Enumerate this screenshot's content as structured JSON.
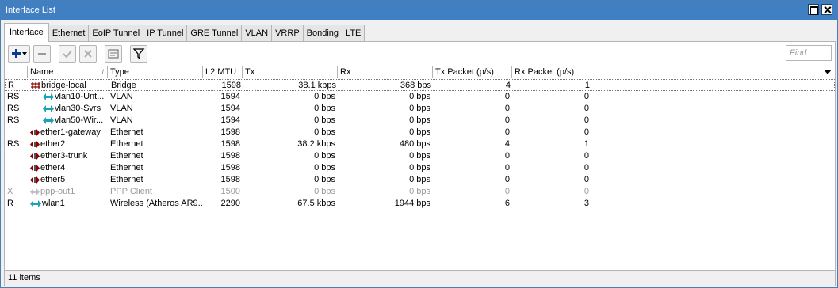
{
  "window": {
    "title": "Interface List"
  },
  "tabs": [
    "Interface",
    "Ethernet",
    "EoIP Tunnel",
    "IP Tunnel",
    "GRE Tunnel",
    "VLAN",
    "VRRP",
    "Bonding",
    "LTE"
  ],
  "toolbar": {
    "add": "plus-icon",
    "remove": "minus-icon",
    "enable": "check-icon",
    "disable": "x-icon",
    "comment": "note-icon",
    "filter": "filter-icon",
    "find_placeholder": "Find"
  },
  "columns": {
    "flag": "",
    "name": "Name",
    "sort": "/",
    "type": "Type",
    "mtu": "L2 MTU",
    "tx": "Tx",
    "rx": "Rx",
    "txp": "Tx Packet (p/s)",
    "rxp": "Rx Packet (p/s)"
  },
  "rows": [
    {
      "flag": "R",
      "icon": "bridge-icon",
      "name": "bridge-local",
      "type": "Bridge",
      "mtu": "1598",
      "tx": "38.1 kbps",
      "rx": "368 bps",
      "txp": "4",
      "rxp": "1",
      "disabled": false
    },
    {
      "flag": "RS",
      "icon": "vlan-icon",
      "name": "vlan10-Unt...",
      "type": "VLAN",
      "mtu": "1594",
      "tx": "0 bps",
      "rx": "0 bps",
      "txp": "0",
      "rxp": "0",
      "disabled": false
    },
    {
      "flag": "RS",
      "icon": "vlan-icon",
      "name": "vlan30-Svrs",
      "type": "VLAN",
      "mtu": "1594",
      "tx": "0 bps",
      "rx": "0 bps",
      "txp": "0",
      "rxp": "0",
      "disabled": false
    },
    {
      "flag": "RS",
      "icon": "vlan-icon",
      "name": "vlan50-Wir...",
      "type": "VLAN",
      "mtu": "1594",
      "tx": "0 bps",
      "rx": "0 bps",
      "txp": "0",
      "rxp": "0",
      "disabled": false
    },
    {
      "flag": "",
      "icon": "ethernet-icon",
      "name": "ether1-gateway",
      "type": "Ethernet",
      "mtu": "1598",
      "tx": "0 bps",
      "rx": "0 bps",
      "txp": "0",
      "rxp": "0",
      "disabled": false
    },
    {
      "flag": "RS",
      "icon": "ethernet-icon",
      "name": "ether2",
      "type": "Ethernet",
      "mtu": "1598",
      "tx": "38.2 kbps",
      "rx": "480 bps",
      "txp": "4",
      "rxp": "1",
      "disabled": false
    },
    {
      "flag": "",
      "icon": "ethernet-icon",
      "name": "ether3-trunk",
      "type": "Ethernet",
      "mtu": "1598",
      "tx": "0 bps",
      "rx": "0 bps",
      "txp": "0",
      "rxp": "0",
      "disabled": false
    },
    {
      "flag": "",
      "icon": "ethernet-icon",
      "name": "ether4",
      "type": "Ethernet",
      "mtu": "1598",
      "tx": "0 bps",
      "rx": "0 bps",
      "txp": "0",
      "rxp": "0",
      "disabled": false
    },
    {
      "flag": "",
      "icon": "ethernet-icon",
      "name": "ether5",
      "type": "Ethernet",
      "mtu": "1598",
      "tx": "0 bps",
      "rx": "0 bps",
      "txp": "0",
      "rxp": "0",
      "disabled": false
    },
    {
      "flag": "X",
      "icon": "ppp-icon",
      "name": "ppp-out1",
      "type": "PPP Client",
      "mtu": "1500",
      "tx": "0 bps",
      "rx": "0 bps",
      "txp": "0",
      "rxp": "0",
      "disabled": true
    },
    {
      "flag": "R",
      "icon": "wireless-icon",
      "name": "wlan1",
      "type": "Wireless (Atheros AR9...",
      "mtu": "2290",
      "tx": "67.5 kbps",
      "rx": "1944 bps",
      "txp": "6",
      "rxp": "3",
      "disabled": false
    }
  ],
  "status": {
    "count": "11 items"
  },
  "colors": {
    "titlebar": "#3f7fc2",
    "vlan_icon": "#1aa3b8",
    "ether_icon": "#8b0000"
  }
}
